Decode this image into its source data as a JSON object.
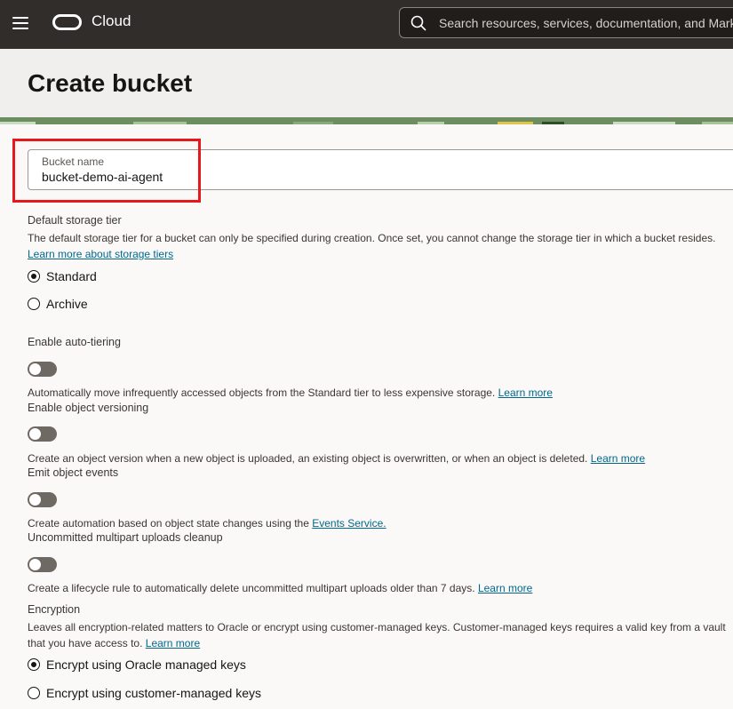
{
  "topbar": {
    "menu_icon": "hamburger-icon",
    "logo_icon": "oracle-logo-icon",
    "brand": "Cloud",
    "search_icon": "search-icon",
    "search_placeholder": "Search resources, services, documentation, and Marketplace"
  },
  "page": {
    "title": "Create bucket"
  },
  "bucket_name": {
    "label": "Bucket name",
    "value": "bucket-demo-ai-agent"
  },
  "storage_tier": {
    "label": "Default storage tier",
    "description": "The default storage tier for a bucket can only be specified during creation. Once set, you cannot change the storage tier in which a bucket resides.",
    "link": "Learn more about storage tiers",
    "options": [
      {
        "label": "Standard",
        "selected": true
      },
      {
        "label": "Archive",
        "selected": false
      }
    ]
  },
  "auto_tiering": {
    "label": "Enable auto-tiering",
    "enabled": false,
    "description": "Automatically move infrequently accessed objects from the Standard tier to less expensive storage.",
    "link": "Learn more"
  },
  "versioning": {
    "label": "Enable object versioning",
    "enabled": false,
    "description": "Create an object version when a new object is uploaded, an existing object is overwritten, or when an object is deleted.",
    "link": "Learn more"
  },
  "events": {
    "label": "Emit object events",
    "enabled": false,
    "description": "Create automation based on object state changes using the",
    "link": "Events Service."
  },
  "multipart": {
    "label": "Uncommitted multipart uploads cleanup",
    "enabled": false,
    "description": "Create a lifecycle rule to automatically delete uncommitted multipart uploads older than 7 days.",
    "link": "Learn more"
  },
  "encryption": {
    "label": "Encryption",
    "description_line1": "Leaves all encryption-related matters to Oracle or encrypt using customer-managed keys. Customer-managed keys requires a valid key from a vault",
    "description_line2": "that you have access to.",
    "link": "Learn more",
    "options": [
      {
        "label": "Encrypt using Oracle managed keys",
        "selected": true
      },
      {
        "label": "Encrypt using customer-managed keys",
        "selected": false
      }
    ]
  },
  "colors": {
    "topbar": "#312d2a",
    "link": "#00688c",
    "highlight": "#e3191b"
  }
}
